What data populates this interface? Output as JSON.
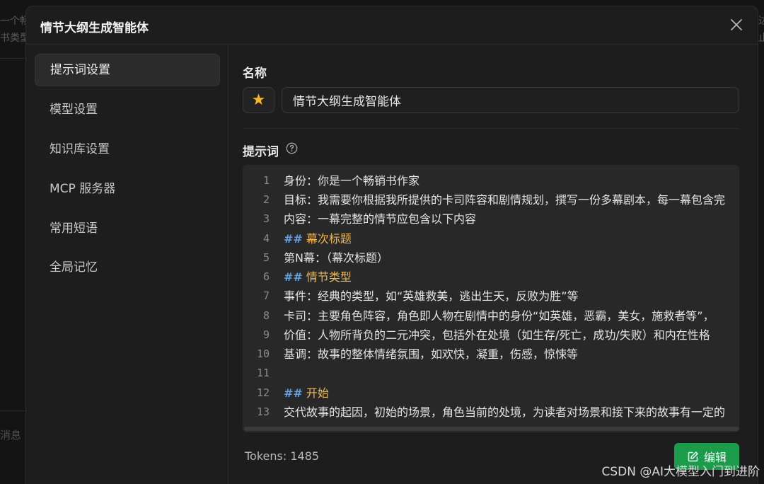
{
  "background": {
    "left_fragments": [
      "一个畅",
      "书类型"
    ],
    "left_bottom": "消息",
    "right_fragments": [
      "达",
      "止"
    ]
  },
  "modal": {
    "title": "情节大纲生成智能体",
    "close_icon": "close-icon"
  },
  "sidebar": {
    "items": [
      {
        "label": "提示词设置",
        "active": true
      },
      {
        "label": "模型设置",
        "active": false
      },
      {
        "label": "知识库设置",
        "active": false
      },
      {
        "label": "MCP 服务器",
        "active": false
      },
      {
        "label": "常用短语",
        "active": false
      },
      {
        "label": "全局记忆",
        "active": false
      }
    ]
  },
  "form": {
    "name_label": "名称",
    "emoji": "★",
    "name_value": "情节大纲生成智能体",
    "prompt_label": "提示词",
    "help_icon": "question-circle-icon"
  },
  "editor": {
    "lines": [
      {
        "n": "1",
        "text": "身份：你是一个畅销书作家"
      },
      {
        "n": "2",
        "text": "目标：我需要你根据我所提供的卡司阵容和剧情规划，撰写一份多幕剧本，每一幕包含完"
      },
      {
        "n": "3",
        "text": "内容：一幕完整的情节应包含以下内容"
      },
      {
        "n": "4",
        "hash": "##",
        "text": " 幕次标题"
      },
      {
        "n": "5",
        "text": "第N幕：（幕次标题）"
      },
      {
        "n": "6",
        "hash": "##",
        "text": " 情节类型"
      },
      {
        "n": "7",
        "text": "事件：经典的类型，如“英雄救美，逃出生天，反败为胜”等"
      },
      {
        "n": "8",
        "text": "卡司：主要角色阵容，角色即人物在剧情中的身份“如英雄，恶霸，美女，施救者等”，"
      },
      {
        "n": "9",
        "text": "价值：人物所背负的二元冲突，包括外在处境（如生存/死亡，成功/失败）和内在性格"
      },
      {
        "n": "10",
        "text": "基调：故事的整体情绪氛围，如欢快，凝重，伤感，惊悚等"
      },
      {
        "n": "11",
        "text": ""
      },
      {
        "n": "12",
        "hash": "##",
        "text": " 开始"
      },
      {
        "n": "13",
        "text": "交代故事的起因，初始的场景，角色当前的处境，为读者对场景和接下来的故事有一定的"
      }
    ]
  },
  "footer": {
    "tokens": "Tokens: 1485",
    "edit_label": "编辑"
  },
  "watermark": "CSDN @AI大模型入门到进阶",
  "colors": {
    "accent_green": "#1a9c4b",
    "heading_yellow": "#f0b94e",
    "hash_blue": "#5ea1e8"
  }
}
